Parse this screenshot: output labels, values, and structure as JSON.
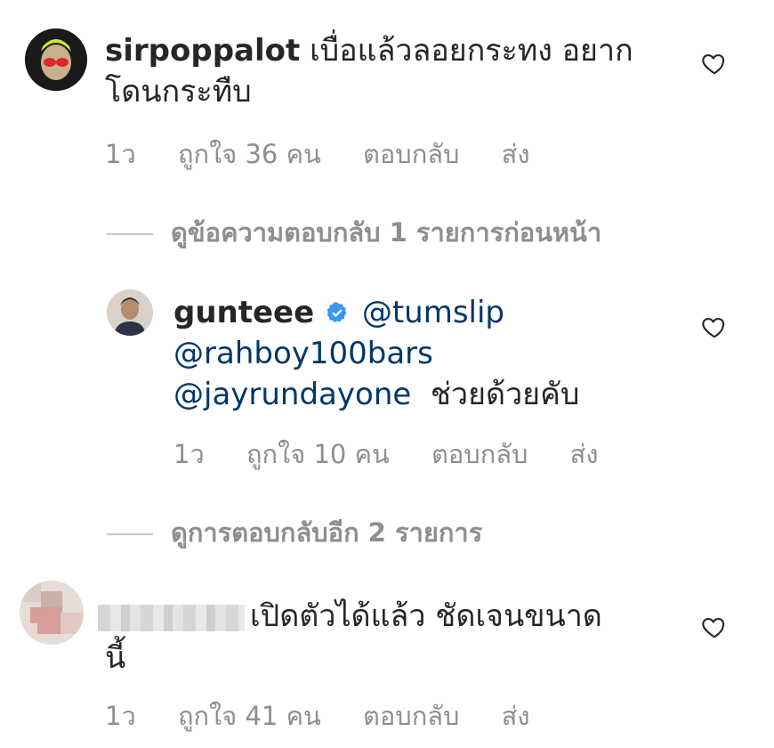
{
  "comments": [
    {
      "username": "sirpoppalot",
      "text": "เบื่อแล้วลอยกระทง อยากโดนกระทืบ",
      "time": "1ว",
      "likes": "ถูกใจ 36 คน",
      "reply": "ตอบกลับ",
      "send": "ส่ง"
    },
    {
      "view_replies": "ดูข้อความตอบกลับ 1 รายการก่อนหน้า"
    },
    {
      "username": "gunteee",
      "mention1": "@tumslip",
      "mention2": "@rahboy100bars",
      "mention3": "@jayrundayone",
      "text": "ช่วยด้วยคับ",
      "time": "1ว",
      "likes": "ถูกใจ 10 คน",
      "reply": "ตอบกลับ",
      "send": "ส่ง"
    },
    {
      "view_replies": "ดูการตอบกลับอีก 2 รายการ"
    },
    {
      "username": "",
      "text_line1": "เปิดตัวได้แล้ว  ชัดเจนขนาด",
      "text_line2": "นี้",
      "time": "1ว",
      "likes": "ถูกใจ 41 คน",
      "reply": "ตอบกลับ",
      "send": "ส่ง"
    }
  ]
}
